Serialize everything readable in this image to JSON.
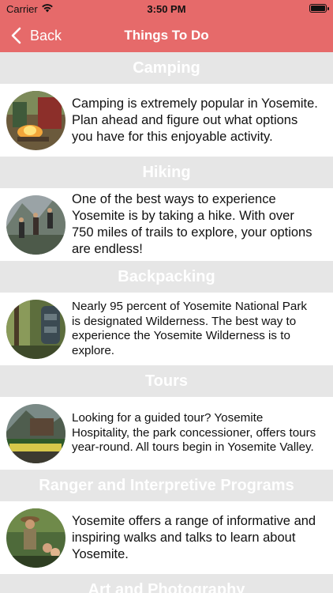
{
  "status_bar": {
    "carrier": "Carrier",
    "time": "3:50 PM"
  },
  "nav": {
    "back_label": "Back",
    "title": "Things To Do"
  },
  "accent_color": "#e66a6a",
  "sections": [
    {
      "header": "Camping",
      "text": "Camping is extremely popular in Yosemite. Plan ahead and figure out what options you have for this enjoyable activity.",
      "icon": "campfire-photo"
    },
    {
      "header": "Hiking",
      "text": "One of the best ways to experience Yosemite is by taking a hike. With over 750 miles of trails to explore, your options are endless!",
      "icon": "hikers-photo"
    },
    {
      "header": "Backpacking",
      "text": "Nearly 95 percent of Yosemite National Park is designated Wilderness. The best way to experience the Yosemite Wilderness is to explore.",
      "icon": "backpacker-photo"
    },
    {
      "header": "Tours",
      "text": "Looking for a guided tour? Yosemite Hospitality, the park concessioner, offers tours year-round. All tours begin in Yosemite Valley.",
      "icon": "tour-tram-photo"
    },
    {
      "header": "Ranger and Interpretive Programs",
      "text": "Yosemite offers a range of informative and inspiring walks and talks to learn about Yosemite.",
      "icon": "ranger-photo"
    },
    {
      "header": "Art and Photography"
    }
  ]
}
